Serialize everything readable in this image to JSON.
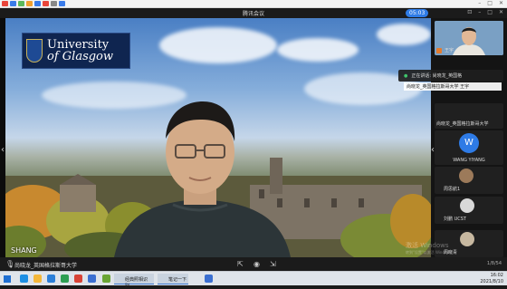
{
  "window": {
    "title": "腾讯会议",
    "timer_badge": "05:03"
  },
  "main_video": {
    "name_tag": "SHANG",
    "logo_line1": "University",
    "logo_line2": "of Glasgow"
  },
  "participants": {
    "speaking_notice": "正在讲话: 尚晓龙_英国格",
    "self_label": "王宇",
    "hint_label": "尚晓龙_英国格拉斯哥大学 王宇",
    "items": [
      {
        "label": "尚晓龙_英国格拉斯哥大学"
      },
      {
        "label": "WANG YIYANG",
        "avatar_letter": "W"
      },
      {
        "label": "周思航1"
      },
      {
        "label": "刘鹏 UCST"
      },
      {
        "label": "周晓青"
      }
    ]
  },
  "watermark": {
    "line1": "激活 Windows",
    "line2": "转到\"设置\"以激活 Windows。"
  },
  "bottom_bar": {
    "speaker_label": "尚晓龙_英国格拉斯哥大学",
    "page_indicator": "1/8/54"
  },
  "taskbar": {
    "app1": "经典照相识别...",
    "app2": "笔记一下",
    "time": "16:02",
    "date": "2021/8/10"
  },
  "colors": {
    "accent_blue": "#2e7be6",
    "logo_navy": "#0f2550"
  }
}
